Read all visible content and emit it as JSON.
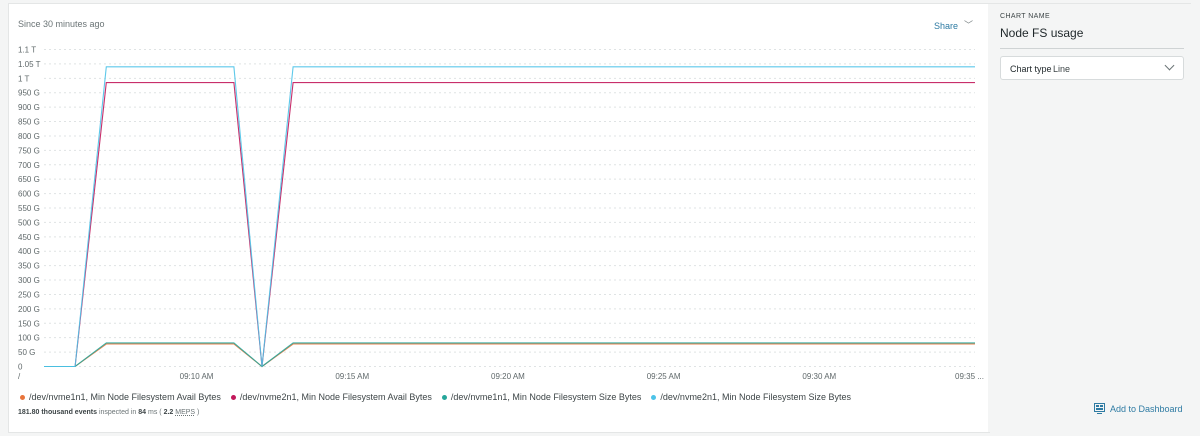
{
  "header": {
    "since": "Since 30 minutes ago",
    "share_label": "Share"
  },
  "chart_data": {
    "type": "line",
    "y_unit_labels": [
      "1.1 T",
      "1.05 T",
      "1 T",
      "950 G",
      "900 G",
      "850 G",
      "800 G",
      "750 G",
      "700 G",
      "650 G",
      "600 G",
      "550 G",
      "500 G",
      "450 G",
      "400 G",
      "350 G",
      "300 G",
      "250 G",
      "200 G",
      "150 G",
      "100 G",
      "50 G",
      "0"
    ],
    "y_ticks_gb": [
      1100,
      1050,
      1000,
      950,
      900,
      850,
      800,
      750,
      700,
      650,
      600,
      550,
      500,
      450,
      400,
      350,
      300,
      250,
      200,
      150,
      100,
      50,
      0
    ],
    "ylim_gb": [
      0,
      1100
    ],
    "x_tick_labels": [
      "09:10 AM",
      "09:15 AM",
      "09:20 AM",
      "09:25 AM",
      "09:30 AM",
      "09:35 ..."
    ],
    "x_ticks_min": [
      10,
      15,
      20,
      25,
      30,
      35
    ],
    "x_first_tick_fragment": "/",
    "x_range_min": [
      5.1,
      35
    ],
    "grid": true,
    "x_unit": "minutes after 09:00 AM",
    "series": [
      {
        "name": "/dev/nvme1n1, Min Node Filesystem Avail Bytes",
        "color": "#e8743b",
        "points": [
          [
            5.1,
            0
          ],
          [
            6.1,
            0
          ],
          [
            7.1,
            78
          ],
          [
            11.2,
            78
          ],
          [
            12.1,
            0
          ],
          [
            13.1,
            78
          ],
          [
            35,
            78
          ]
        ]
      },
      {
        "name": "/dev/nvme2n1, Min Node Filesystem Avail Bytes",
        "color": "#c2185b",
        "points": [
          [
            5.1,
            0
          ],
          [
            6.1,
            0
          ],
          [
            7.1,
            985
          ],
          [
            11.2,
            985
          ],
          [
            12.1,
            0
          ],
          [
            13.1,
            985
          ],
          [
            35,
            985
          ]
        ]
      },
      {
        "name": "/dev/nvme1n1, Min Node Filesystem Size Bytes",
        "color": "#26a69a",
        "points": [
          [
            5.1,
            0
          ],
          [
            6.1,
            0
          ],
          [
            7.1,
            82
          ],
          [
            11.2,
            82
          ],
          [
            12.1,
            0
          ],
          [
            13.1,
            82
          ],
          [
            35,
            82
          ]
        ]
      },
      {
        "name": "/dev/nvme2n1, Min Node Filesystem Size Bytes",
        "color": "#4dc3e8",
        "points": [
          [
            5.1,
            0
          ],
          [
            6.1,
            0
          ],
          [
            7.1,
            1040
          ],
          [
            11.2,
            1040
          ],
          [
            12.1,
            0
          ],
          [
            13.1,
            1040
          ],
          [
            35,
            1040
          ]
        ]
      }
    ]
  },
  "footer": {
    "events": "181.80 thousand events",
    "inspected_in": "inspected in",
    "ms_value": "84",
    "ms_unit": "ms (",
    "meps_value": "2.2",
    "meps_unit": "MEPS",
    "close": ")"
  },
  "panel": {
    "chart_name_label": "CHART NAME",
    "chart_name_value": "Node FS usage",
    "chart_type_label": "Chart type",
    "chart_type_value": "Line",
    "add_to_dashboard": "Add to Dashboard"
  }
}
